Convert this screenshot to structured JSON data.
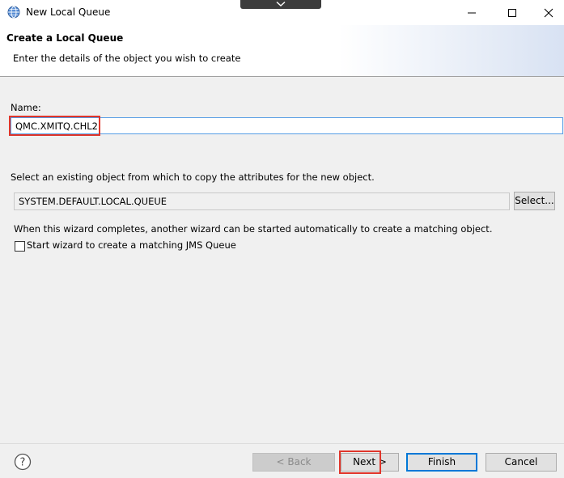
{
  "window": {
    "title": "New Local Queue"
  },
  "banner": {
    "title": "Create a Local Queue",
    "description": "Enter the details of the object you wish to create"
  },
  "form": {
    "name_label": "Name:",
    "name_value": "QMC.XMITQ.CHL2",
    "copy_label": "Select an existing object from which to copy the attributes for the new object.",
    "copy_value": "SYSTEM.DEFAULT.LOCAL.QUEUE",
    "select_button": "Select...",
    "wizard_info": "When this wizard completes, another wizard can be started automatically to create a matching object.",
    "jms_checkbox_label": "Start wizard to create a matching JMS Queue",
    "jms_checkbox_checked": false
  },
  "footer": {
    "back_label": "< Back",
    "next_label": "Next >",
    "finish_label": "Finish",
    "cancel_label": "Cancel"
  },
  "icons": {
    "app": "globe-icon",
    "help": "help-icon",
    "minimize": "minimize-icon",
    "maximize": "maximize-icon",
    "close": "close-icon",
    "collapse": "chevron-down-icon"
  },
  "colors": {
    "highlight": "#e0362b",
    "focus": "#0078d7"
  }
}
